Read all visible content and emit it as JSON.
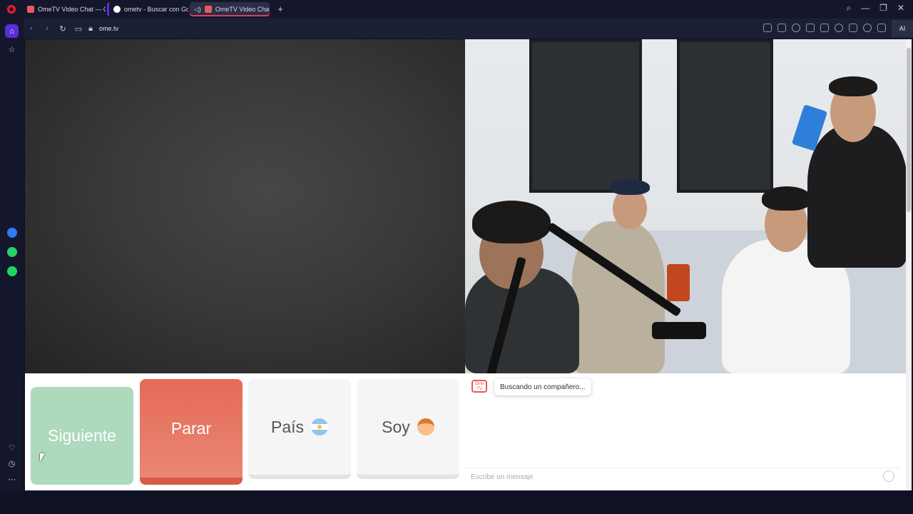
{
  "browser": {
    "tabs": [
      {
        "title": "OmeTV Video Chat — Om",
        "favicon_color": "#e35b5b"
      },
      {
        "title": "ometv - Buscar con Goog",
        "favicon_color": "#ffffff"
      },
      {
        "title": "OmeTV Video Chat —",
        "favicon_color": "#e35b5b",
        "active": true,
        "audio": true
      }
    ],
    "new_tab_label": "+",
    "address": "ome.tv",
    "ai_label": "AI"
  },
  "colors": {
    "accent": "#5a2dd8",
    "opera_red": "#ff1b2d",
    "next_button": "#a9d7b9",
    "stop_button": "#e56a56",
    "messenger": "#2e7cf6",
    "whatsapp": "#25d366",
    "spotify": "#1ed760"
  },
  "sidebar": {
    "icons": [
      "home-icon",
      "star-icon",
      "messenger-icon",
      "whatsapp-icon",
      "spotify-icon",
      "heart-icon",
      "history-icon",
      "more-icon"
    ]
  },
  "controls": {
    "next_label": "Siguiente",
    "stop_label": "Parar",
    "country_label": "País",
    "gender_label": "Soy"
  },
  "chat": {
    "logo_text": "Ome TV",
    "status_message": "Buscando un compañero...",
    "input_placeholder": "Escribe un mensaje"
  }
}
